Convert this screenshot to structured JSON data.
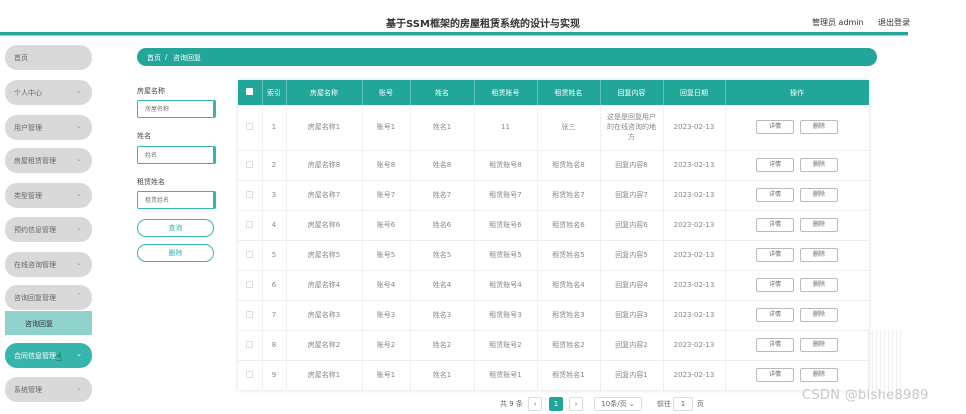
{
  "header": {
    "title": "基于SSM框架的房屋租赁系统的设计与实现",
    "user": "管理员 admin",
    "logout": "退出登录"
  },
  "sidebar": {
    "items": [
      {
        "label": "首页"
      },
      {
        "label": "个人中心"
      },
      {
        "label": "用户管理"
      },
      {
        "label": "房屋租赁管理"
      },
      {
        "label": "类型管理"
      },
      {
        "label": "预约信息管理"
      },
      {
        "label": "在线咨询管理"
      },
      {
        "label": "咨询回复管理"
      },
      {
        "label": "合同信息管理"
      },
      {
        "label": "系统管理"
      }
    ],
    "sub_item": "咨询回复"
  },
  "breadcrumb": {
    "home": "首页",
    "sep": "/",
    "current": "咨询回复"
  },
  "search": {
    "house_label": "房屋名称",
    "house_placeholder": "房屋名称",
    "name_label": "姓名",
    "name_placeholder": "姓名",
    "renter_label": "租赁姓名",
    "renter_placeholder": "租赁姓名",
    "query_button": "查询",
    "delete_button": "删除"
  },
  "table": {
    "headers": [
      "索引",
      "房屋名称",
      "账号",
      "姓名",
      "租赁账号",
      "租赁姓名",
      "回复内容",
      "回复日期",
      "操作"
    ],
    "rows": [
      [
        "1",
        "房屋名称1",
        "账号1",
        "姓名1",
        "11",
        "张三",
        "这是是回复用户的在线咨询的地方",
        "2023-02-13"
      ],
      [
        "2",
        "房屋名称8",
        "账号8",
        "姓名8",
        "租赁账号8",
        "租赁姓名8",
        "回复内容8",
        "2023-02-13"
      ],
      [
        "3",
        "房屋名称7",
        "账号7",
        "姓名7",
        "租赁账号7",
        "租赁姓名7",
        "回复内容7",
        "2023-02-13"
      ],
      [
        "4",
        "房屋名称6",
        "账号6",
        "姓名6",
        "租赁账号6",
        "租赁姓名6",
        "回复内容6",
        "2023-02-13"
      ],
      [
        "5",
        "房屋名称5",
        "账号5",
        "姓名5",
        "租赁账号5",
        "租赁姓名5",
        "回复内容5",
        "2023-02-13"
      ],
      [
        "6",
        "房屋名称4",
        "账号4",
        "姓名4",
        "租赁账号4",
        "租赁姓名4",
        "回复内容4",
        "2023-02-13"
      ],
      [
        "7",
        "房屋名称3",
        "账号3",
        "姓名3",
        "租赁账号3",
        "租赁姓名3",
        "回复内容3",
        "2023-02-13"
      ],
      [
        "8",
        "房屋名称2",
        "账号2",
        "姓名2",
        "租赁账号2",
        "租赁姓名2",
        "回复内容2",
        "2023-02-13"
      ],
      [
        "9",
        "房屋名称1",
        "账号1",
        "姓名1",
        "租赁账号1",
        "租赁姓名1",
        "回复内容1",
        "2023-02-13"
      ]
    ],
    "detail_button": "详情",
    "delete_button": "删除"
  },
  "pagination": {
    "total": "共 9 条",
    "prev": "‹",
    "current_page": "1",
    "next": "›",
    "page_size": "10条/页",
    "goto_label": "前往",
    "goto_value": "1",
    "page_unit": "页"
  },
  "watermark": "CSDN @bishe8989"
}
